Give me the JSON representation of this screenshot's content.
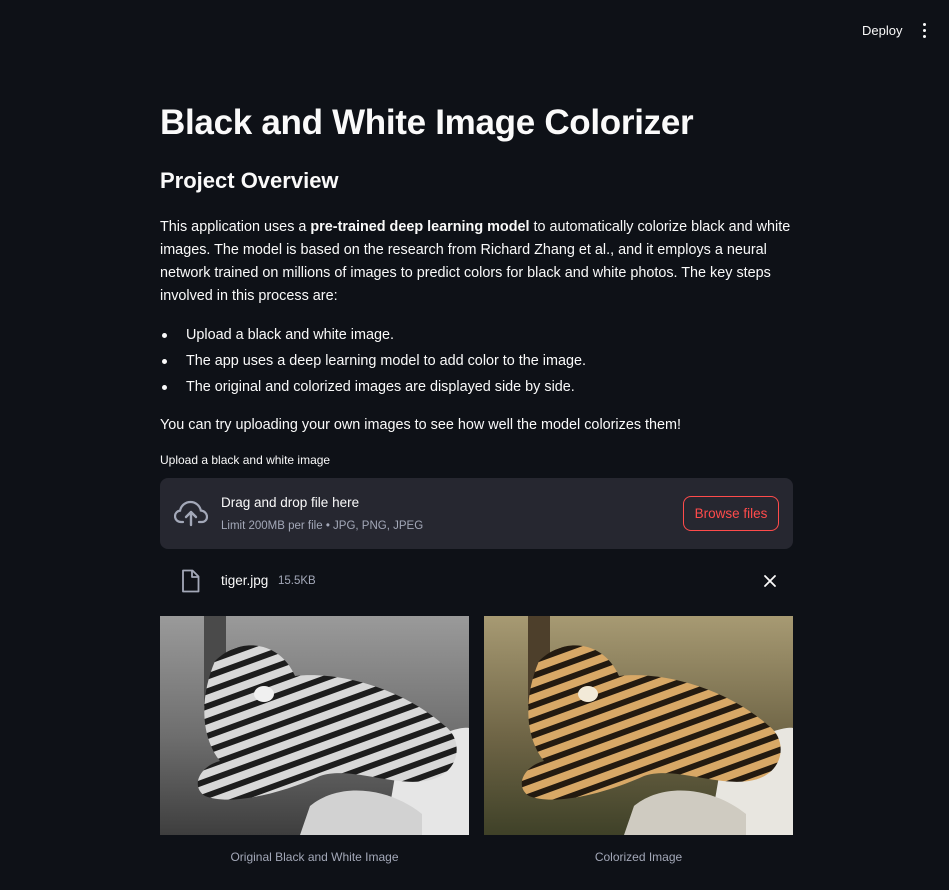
{
  "header": {
    "deploy_label": "Deploy",
    "menu_icon": "more-vertical-icon"
  },
  "page": {
    "title": "Black and White Image Colorizer",
    "subtitle": "Project Overview",
    "intro_pre": "This application uses a ",
    "intro_bold": "pre-trained deep learning model",
    "intro_post": " to automatically colorize black and white images. The model is based on the research from Richard Zhang et al., and it employs a neural network trained on millions of images to predict colors for black and white photos. The key steps involved in this process are:",
    "steps": [
      "Upload a black and white image.",
      "The app uses a deep learning model to add color to the image.",
      "The original and colorized images are displayed side by side."
    ],
    "closing": "You can try uploading your own images to see how well the model colorizes them!"
  },
  "uploader": {
    "label": "Upload a black and white image",
    "drop_title": "Drag and drop file here",
    "limit_text": "Limit 200MB per file • JPG, PNG, JPEG",
    "browse_label": "Browse files",
    "icon": "cloud-upload-icon",
    "accent_color": "#ff4b4b"
  },
  "uploaded_file": {
    "name": "tiger.jpg",
    "size": "15.5KB",
    "icon": "file-icon",
    "remove_icon": "close-icon"
  },
  "results": {
    "original_caption": "Original Black and White Image",
    "colorized_caption": "Colorized Image"
  },
  "colors": {
    "background": "#0e1117",
    "surface": "#262730",
    "text": "#fafafa",
    "muted": "#a3a8b8"
  }
}
